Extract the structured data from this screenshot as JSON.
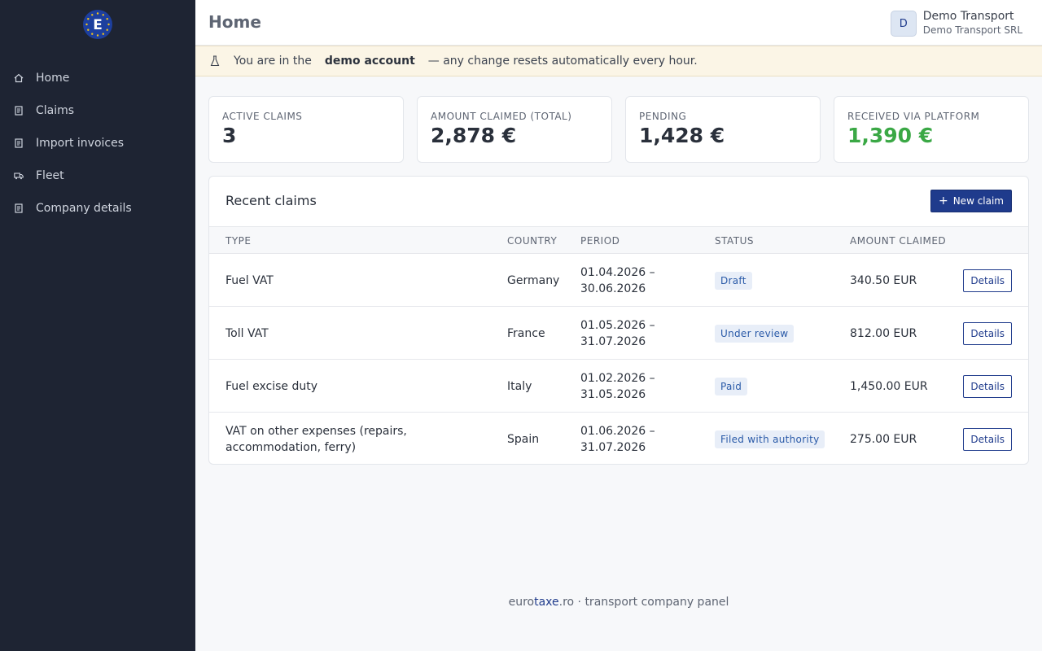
{
  "sidebar": {
    "logo_letter": "E",
    "items": [
      {
        "label": "Home",
        "icon": "home-icon"
      },
      {
        "label": "Claims",
        "icon": "document-icon"
      },
      {
        "label": "Import invoices",
        "icon": "document-icon"
      },
      {
        "label": "Fleet",
        "icon": "truck-icon"
      },
      {
        "label": "Company details",
        "icon": "document-icon"
      }
    ]
  },
  "header": {
    "title": "Home",
    "avatar_letter": "D",
    "account_name": "Demo Transport",
    "account_company": "Demo Transport SRL"
  },
  "banner": {
    "icon": "flask-icon",
    "prefix": "You are in the",
    "highlight": "demo account",
    "suffix": "— any change resets automatically every hour."
  },
  "stats": [
    {
      "label": "ACTIVE CLAIMS",
      "value": "3",
      "color": "#2a303b"
    },
    {
      "label": "AMOUNT CLAIMED (TOTAL)",
      "value": "2,878 €",
      "color": "#2a303b"
    },
    {
      "label": "PENDING",
      "value": "1,428 €",
      "color": "#2a303b"
    },
    {
      "label": "RECEIVED VIA PLATFORM",
      "value": "1,390 €",
      "color": "#3aa845"
    }
  ],
  "claims": {
    "title": "Recent claims",
    "new_button": "New claim",
    "columns": {
      "type": "TYPE",
      "country": "COUNTRY",
      "period": "PERIOD",
      "status": "STATUS",
      "amount": "AMOUNT CLAIMED"
    },
    "rows": [
      {
        "type": "Fuel VAT",
        "country": "Germany",
        "period": "01.04.2026 – 30.06.2026",
        "status": "Draft",
        "amount": "340.50 EUR",
        "action": "Details"
      },
      {
        "type": "Toll VAT",
        "country": "France",
        "period": "01.05.2026 – 31.07.2026",
        "status": "Under review",
        "amount": "812.00 EUR",
        "action": "Details"
      },
      {
        "type": "Fuel excise duty",
        "country": "Italy",
        "period": "01.02.2026 – 31.05.2026",
        "status": "Paid",
        "amount": "1,450.00 EUR",
        "action": "Details"
      },
      {
        "type": "VAT on other expenses (repairs, accommodation, ferry)",
        "country": "Spain",
        "period": "01.06.2026 – 31.07.2026",
        "status": "Filed with authority",
        "amount": "275.00 EUR",
        "action": "Details"
      }
    ]
  },
  "footer": {
    "brand_pre": "euro",
    "brand_accent": "taxe",
    "brand_post": ".ro",
    "tagline": " · transport company panel"
  },
  "colors": {
    "sidebar_bg": "#1e2433",
    "primary": "#1f3b8c",
    "success": "#3aa845",
    "banner_bg": "#fbf5e6"
  }
}
